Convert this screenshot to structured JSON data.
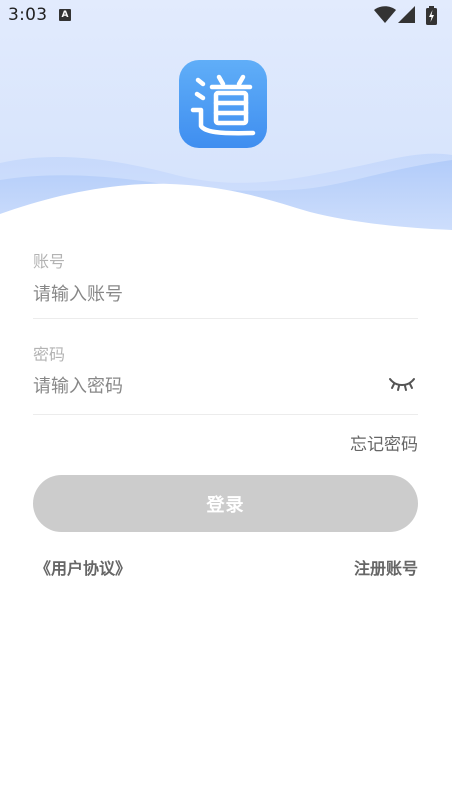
{
  "status_bar": {
    "time": "3:03",
    "notification_icon_letter": "A",
    "icons": [
      "a-notification-icon",
      "wifi-icon",
      "cellular-signal-icon",
      "battery-charging-icon"
    ]
  },
  "header": {
    "logo_icon": "app-logo-icon",
    "logo_colors": [
      "#60aef8",
      "#3f8ef0"
    ]
  },
  "form": {
    "account": {
      "label": "账号",
      "placeholder": "请输入账号",
      "value": ""
    },
    "password": {
      "label": "密码",
      "placeholder": "请输入密码",
      "value": "",
      "visibility_icon": "eye-closed-icon"
    },
    "forgot_label": "忘记密码",
    "login_label": "登录"
  },
  "footer": {
    "agreement_label": "《用户协议》",
    "register_label": "注册账号"
  },
  "colors": {
    "accent": "#4a96f2",
    "button_disabled": "#cccccc",
    "label_gray": "#b3b3b3",
    "link_gray": "#666666"
  }
}
